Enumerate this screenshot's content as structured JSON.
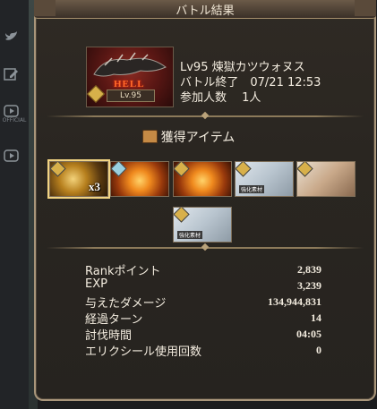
{
  "header": {
    "title": "バトル結果"
  },
  "sidebar": {
    "items": [
      {
        "icon": "twitter-icon",
        "label": ""
      },
      {
        "icon": "edit-icon",
        "label": ""
      },
      {
        "icon": "youtube-icon",
        "label": "OFFICIAL"
      },
      {
        "icon": "youtube-icon",
        "label": ""
      }
    ]
  },
  "quest": {
    "name_line": "Lv95 煉獄カツウォヌス",
    "end_line": "バトル終了　07/21 12:53",
    "participants_line": "参加人数　 1人",
    "difficulty": "HELL",
    "level_badge": "Lv.95"
  },
  "items_section": {
    "title": "獲得アイテム",
    "items": [
      {
        "kind": "gold",
        "qty": "x3",
        "selected": true
      },
      {
        "kind": "orange",
        "qty": ""
      },
      {
        "kind": "orange",
        "qty": ""
      },
      {
        "kind": "silver",
        "qty": "",
        "tag": "強化素材"
      },
      {
        "kind": "portrait",
        "qty": "",
        "tag": ""
      },
      {
        "kind": "silver",
        "qty": "",
        "tag": "強化素材"
      }
    ]
  },
  "stats": [
    {
      "label": "Rankポイント",
      "value": "2,839"
    },
    {
      "label": "EXP",
      "value": "3,239"
    },
    {
      "label": "与えたダメージ",
      "value": "134,944,831"
    },
    {
      "label": "経過ターン",
      "value": "14"
    },
    {
      "label": "討伐時間",
      "value": "04:05"
    },
    {
      "label": "エリクシール使用回数",
      "value": "0"
    }
  ]
}
